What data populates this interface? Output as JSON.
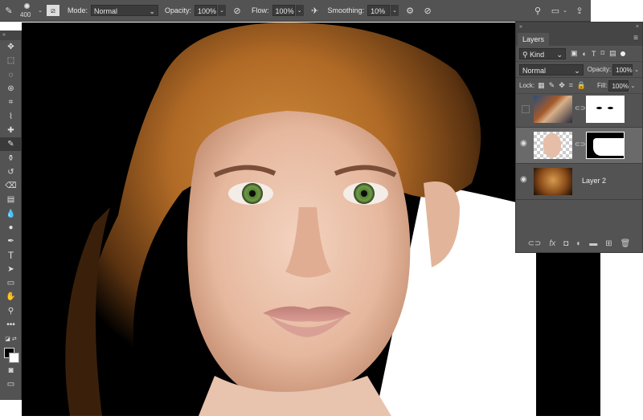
{
  "options_bar": {
    "brush_size": "400",
    "mode_label": "Mode:",
    "mode_value": "Normal",
    "opacity_label": "Opacity:",
    "opacity_value": "100%",
    "flow_label": "Flow:",
    "flow_value": "100%",
    "smoothing_label": "Smoothing:",
    "smoothing_value": "10%"
  },
  "tools": [
    "move-tool",
    "marquee-tool",
    "lasso-tool",
    "quick-select-tool",
    "crop-tool",
    "eyedropper-tool",
    "healing-brush-tool",
    "brush-tool",
    "clone-stamp-tool",
    "history-brush-tool",
    "eraser-tool",
    "gradient-tool",
    "blur-tool",
    "dodge-tool",
    "pen-tool",
    "type-tool",
    "path-select-tool",
    "rectangle-tool",
    "hand-tool",
    "zoom-tool",
    "more-tools",
    "default-colors",
    "swatches",
    "quick-mask",
    "screen-mode"
  ],
  "layers_panel": {
    "tab": "Layers",
    "filter_kind": "Kind",
    "blend_mode": "Normal",
    "opacity_label": "Opacity:",
    "opacity_value": "100%",
    "lock_label": "Lock:",
    "fill_label": "Fill:",
    "fill_value": "100%",
    "layers": [
      {
        "name": "",
        "visible": false
      },
      {
        "name": "",
        "visible": true
      },
      {
        "name": "Layer 2",
        "visible": true
      }
    ]
  },
  "colors": {
    "ui_bg": "#535353",
    "ui_dark": "#3b3b3b",
    "accent": "#e8e8e8"
  }
}
